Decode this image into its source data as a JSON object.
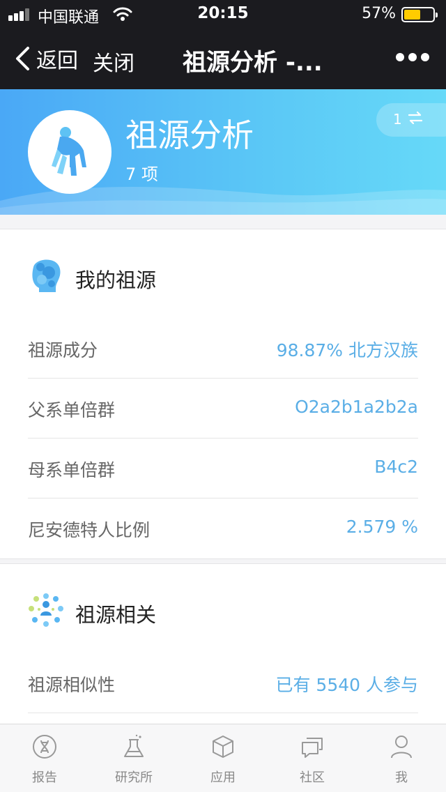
{
  "status_bar": {
    "carrier": "中国联通",
    "time": "20:15",
    "battery_percent": "57%",
    "battery_level": 0.57,
    "signal_bars": 3
  },
  "nav": {
    "back_label": "返回",
    "close_label": "关闭",
    "title": "祖源分析 -..."
  },
  "banner": {
    "title": "祖源分析",
    "subtitle": "7 项",
    "switch_count": "1",
    "icon": "ape-icon",
    "accent": "#4aa8f6"
  },
  "my_ancestry": {
    "title": "我的祖源",
    "icon": "face-profile-icon",
    "rows": [
      {
        "label": "祖源成分",
        "value": "98.87% 北方汉族"
      },
      {
        "label": "父系单倍群",
        "value": "O2a2b1a2b2a"
      },
      {
        "label": "母系单倍群",
        "value": "B4c2"
      },
      {
        "label": "尼安德特人比例",
        "value": "2.579 %"
      }
    ]
  },
  "related": {
    "title": "祖源相关",
    "icon": "network-icon",
    "rows": [
      {
        "label": "祖源相似性",
        "value": "已有 5540 人参与"
      }
    ]
  },
  "tabbar": {
    "items": [
      {
        "label": "报告",
        "icon": "dna-icon"
      },
      {
        "label": "研究所",
        "icon": "flask-icon"
      },
      {
        "label": "应用",
        "icon": "cube-icon"
      },
      {
        "label": "社区",
        "icon": "chat-icon"
      },
      {
        "label": "我",
        "icon": "person-icon"
      }
    ]
  },
  "colors": {
    "value_blue": "#5aaee6",
    "battery_yellow": "#ffcc00",
    "dark_bar": "#1b1b1f"
  }
}
